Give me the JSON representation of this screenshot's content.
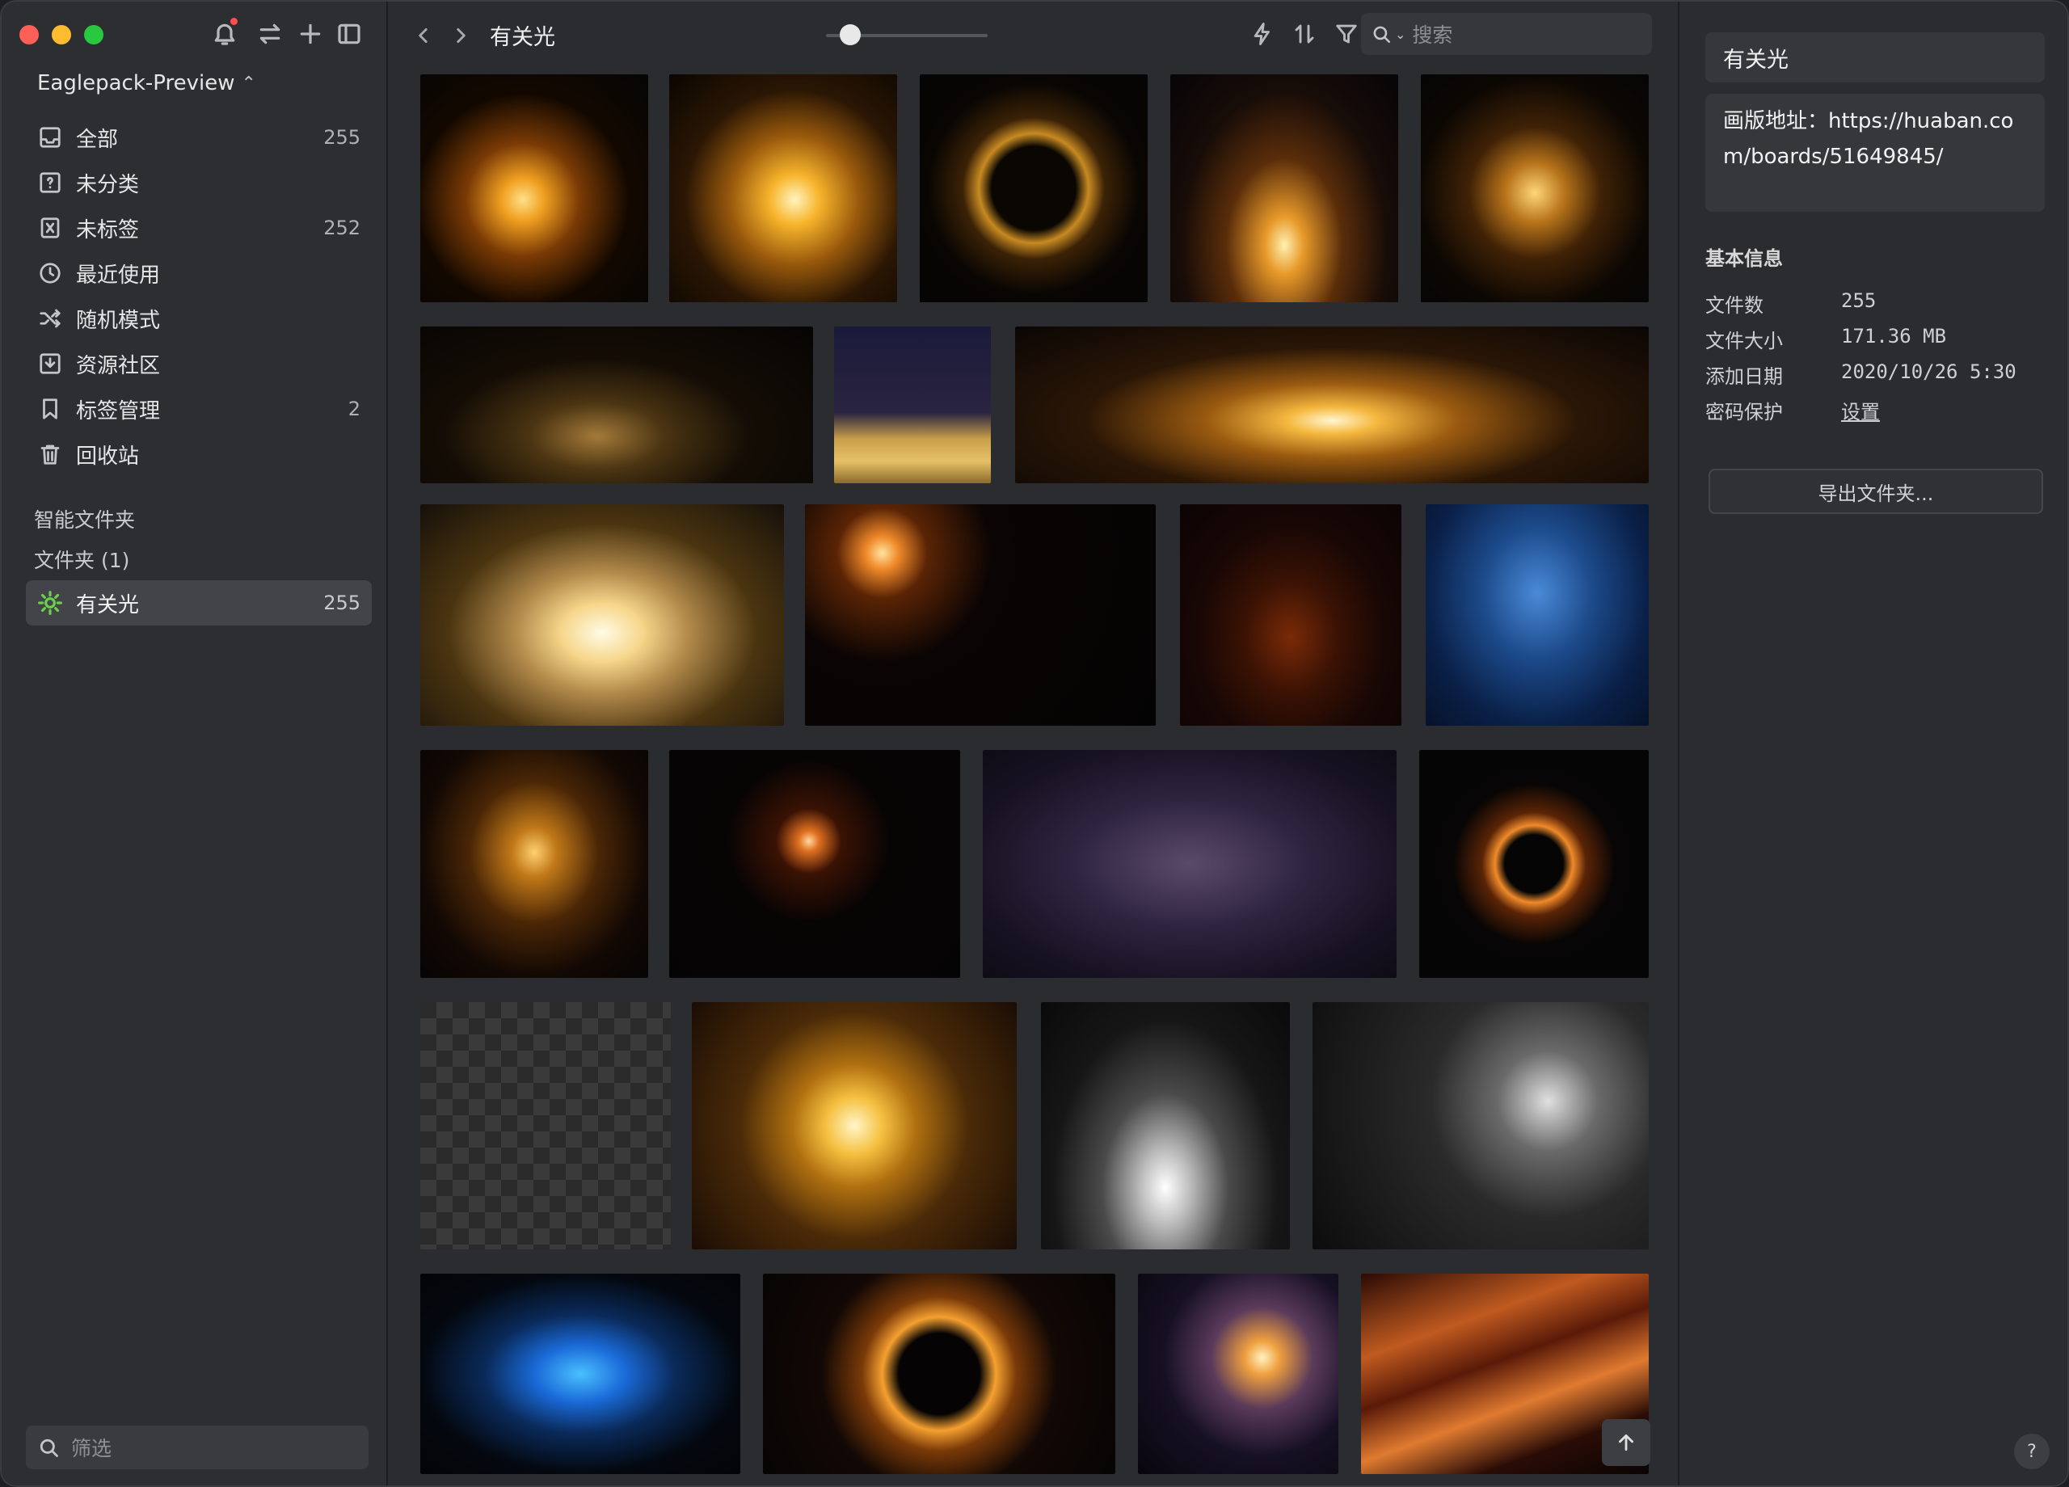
{
  "library": {
    "name": "Eaglepack-Preview"
  },
  "sidebar": {
    "items": [
      {
        "label": "全部",
        "count": "255",
        "icon": "inbox-icon"
      },
      {
        "label": "未分类",
        "count": "",
        "icon": "unfiled-icon"
      },
      {
        "label": "未标签",
        "count": "252",
        "icon": "untagged-icon"
      },
      {
        "label": "最近使用",
        "count": "",
        "icon": "clock-icon"
      },
      {
        "label": "随机模式",
        "count": "",
        "icon": "shuffle-icon"
      },
      {
        "label": "资源社区",
        "count": "",
        "icon": "download-icon"
      },
      {
        "label": "标签管理",
        "count": "2",
        "icon": "bookmark-icon"
      },
      {
        "label": "回收站",
        "count": "",
        "icon": "trash-icon"
      }
    ],
    "smart_folders_label": "智能文件夹",
    "folders_label": "文件夹 (1)",
    "folder": {
      "label": "有关光",
      "count": "255",
      "icon": "sun-icon"
    },
    "filter_placeholder": "筛选"
  },
  "main": {
    "title": "有关光",
    "search_placeholder": "搜索",
    "zoom_level": 0.15
  },
  "inspector": {
    "name": "有关光",
    "description": "画版地址：https://huaban.com/boards/51649845/",
    "basic_info_title": "基本信息",
    "rows": [
      {
        "k": "文件数",
        "v": "255"
      },
      {
        "k": "文件大小",
        "v": "171.36 MB"
      },
      {
        "k": "添加日期",
        "v": "2020/10/26 5:30"
      },
      {
        "k": "密码保护",
        "v": "设置"
      }
    ],
    "export_label": "导出文件夹...",
    "help_label": "?"
  },
  "colors": {
    "accent_green": "#6cd04a",
    "notification_red": "#ff4d4f",
    "traffic_red": "#fe5f57",
    "traffic_yellow": "#febc2e",
    "traffic_green": "#28c840"
  },
  "thumbnails": [
    {
      "name": "golden-swirl-light",
      "bg": "radial-gradient(circle at 45% 55%, #ffe08a 0%, #f0a020 12%, #7a3a05 32%, #120800 60%, #050505 100%)"
    },
    {
      "name": "golden-sparkle-burst",
      "bg": "radial-gradient(circle at 55% 55%, #fff4c0 0%, #f7b52c 14%, #9a5a0c 36%, #2a1604 62%, #0a0602 100%)"
    },
    {
      "name": "golden-ring-sparkles",
      "bg": "radial-gradient(circle at 50% 50%, #0a0602 26%, #c78a22 34%, #3b2206 44%, #080503 66%, #050505 100%)"
    },
    {
      "name": "golden-christmas-tree",
      "bg": "radial-gradient(ellipse at 50% 75%, #fff0b0 0%, #e89a2a 12%, #5a2d0a 36%, #170c08 64%, #070507 100%)"
    },
    {
      "name": "golden-triangle-glow",
      "bg": "radial-gradient(circle at 50% 52%, #ffd67a 0%, #b8741a 18%, #402206 40%, #0c0703 70%, #050505 100%)"
    },
    {
      "name": "light-ring-ground",
      "bg": "radial-gradient(ellipse at 45% 70%, #a47a3a 0%, #4a3412 22%, #140d05 50%, #060404 100%)"
    },
    {
      "name": "golden-glitter-floor",
      "bg": "linear-gradient(180deg, #1a1a3a 0%, #2a2440 55%, #c9a04a 72%, #e6c068 86%, #8a6a2a 100%)"
    },
    {
      "name": "golden-explosion-rays",
      "bg": "radial-gradient(ellipse at 50% 60%, #fff6d0 0%, #f5b940 10%, #9a5a10 28%, #2a1606 55%, #0a0605 100%)"
    },
    {
      "name": "golden-stage-curtains",
      "bg": "radial-gradient(ellipse at 50% 58%, #fffbe6 0%, #f6d68a 16%, #b0884a 34%, #4a3410 60%, #15100a 100%)"
    },
    {
      "name": "orange-lens-flare",
      "bg": "radial-gradient(circle at 22% 22%, #ffe4a0 0%, #f08a2a 5%, #5a2405 14%, #0a0404 34%, #040303 100%)"
    },
    {
      "name": "merry-christmas-snowflake",
      "bg": "radial-gradient(ellipse at 50% 60%, #7a2a08 0%, #3a1204 30%, #180705 60%, #0c0404 100%)"
    },
    {
      "name": "blue-glitter-bokeh",
      "bg": "radial-gradient(ellipse at 50% 40%, #4a8ad8 0%, #1c4a8a 35%, #0a2048 70%, #06122a 100%)"
    },
    {
      "name": "golden-spiral-tree",
      "bg": "radial-gradient(ellipse at 50% 45%, #ffd070 0%, #c07818 14%, #4a2606 40%, #120804 70%, #050404 100%)"
    },
    {
      "name": "orange-streak-flare",
      "bg": "radial-gradient(circle at 48% 40%, #ffd9a0 0%, #e07020 5%, #3a1204 16%, #070404 40%, #050404 100%)"
    },
    {
      "name": "silver-swirl-purple",
      "bg": "radial-gradient(ellipse at 50% 50%, #5a4a6a 0%, #2e2440 40%, #171222 75%, #0e0b16 100%)"
    },
    {
      "name": "orange-light-ring",
      "bg": "radial-gradient(ellipse at 50% 50%, #050505 18%, #f08a2a 24%, #5a2406 32%, #070505 50%, #050505 100%)"
    },
    {
      "name": "golden-swirl-transparent",
      "bg": "repeating-conic-gradient(#3a3a3a 0% 25%, #2a2a2a 0% 50%) 0 0 / 40px 40px"
    },
    {
      "name": "golden-portal-glow",
      "bg": "radial-gradient(circle at 50% 50%, #fff6c8 0%, #f5c040 14%, #b07010 30%, #4a2a08 56%, #1a0d05 100%)"
    },
    {
      "name": "white-dandelion-burst",
      "bg": "radial-gradient(ellipse at 50% 75%, #ffffff 0%, #bdbdbd 14%, #4a4a4a 36%, #161616 64%, #0a0a0a 100%)"
    },
    {
      "name": "white-bokeh-dots",
      "bg": "radial-gradient(circle at 70% 40%, #e0e0e0 0%, #6a6a6a 18%, #2a2a2a 42%, #0c0c0c 100%)"
    },
    {
      "name": "blue-energy-swirl",
      "bg": "radial-gradient(ellipse at 50% 50%, #4ac0ff 0%, #1a6ad8 20%, #0a2a5a 42%, #04080f 70%, #030406 100%)"
    },
    {
      "name": "fire-ring",
      "bg": "radial-gradient(circle at 50% 50%, #050303 20%, #f5a030 28%, #7a3a08 38%, #120805 58%, #060404 100%)"
    },
    {
      "name": "sunburst-flare",
      "bg": "radial-gradient(circle at 62% 42%, #fff2c0 0%, #f0a040 10%, #5a3a5a 30%, #161024 58%, #08060c 100%)"
    },
    {
      "name": "orange-speed-streaks",
      "bg": "linear-gradient(160deg, #2a0a05 0%, #c05a20 28%, #5a1a08 45%, #e07a30 62%, #2a0c06 80%, #0a0404 100%)"
    }
  ]
}
